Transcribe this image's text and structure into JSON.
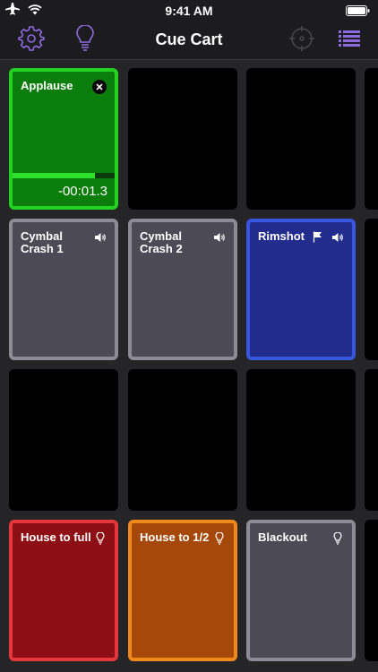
{
  "status_bar": {
    "time": "9:41 AM",
    "icons": [
      "airplane-icon",
      "wifi-icon",
      "battery-icon"
    ]
  },
  "nav": {
    "title": "Cue Cart",
    "left_buttons": [
      "gear-icon",
      "lightbulb-icon"
    ],
    "right_buttons": [
      "target-icon",
      "list-icon"
    ],
    "accent_color": "#8e6ae0"
  },
  "cues": [
    {
      "id": "applause",
      "name": "Applause",
      "color": "#0a7d0a",
      "border": "#23d223",
      "status": "playing",
      "remaining": "-00:01.3",
      "progress": 0.81,
      "icons": [
        "stop-icon"
      ]
    },
    {
      "id": "cymbal-crash-1",
      "name": "Cymbal Crash 1",
      "color": "#4b4a55",
      "border": "#8d8c96",
      "icons": [
        "speaker-icon"
      ]
    },
    {
      "id": "cymbal-crash-2",
      "name": "Cymbal Crash 2",
      "color": "#4b4a55",
      "border": "#8d8c96",
      "icons": [
        "speaker-icon"
      ]
    },
    {
      "id": "rimshot",
      "name": "Rimshot",
      "color": "#222c8c",
      "border": "#3956de",
      "icons": [
        "flag-icon",
        "speaker-icon"
      ]
    },
    {
      "id": "house-to-full",
      "name": "House to full",
      "color": "#8d0e14",
      "border": "#e5363b",
      "icons": [
        "lightbulb-icon"
      ]
    },
    {
      "id": "house-to-half",
      "name": "House to 1/2",
      "color": "#a6480a",
      "border": "#f0891b",
      "icons": [
        "lightbulb-icon"
      ]
    },
    {
      "id": "blackout",
      "name": "Blackout",
      "color": "#4b4a55",
      "border": "#8d8c96",
      "icons": [
        "lightbulb-icon"
      ]
    }
  ]
}
